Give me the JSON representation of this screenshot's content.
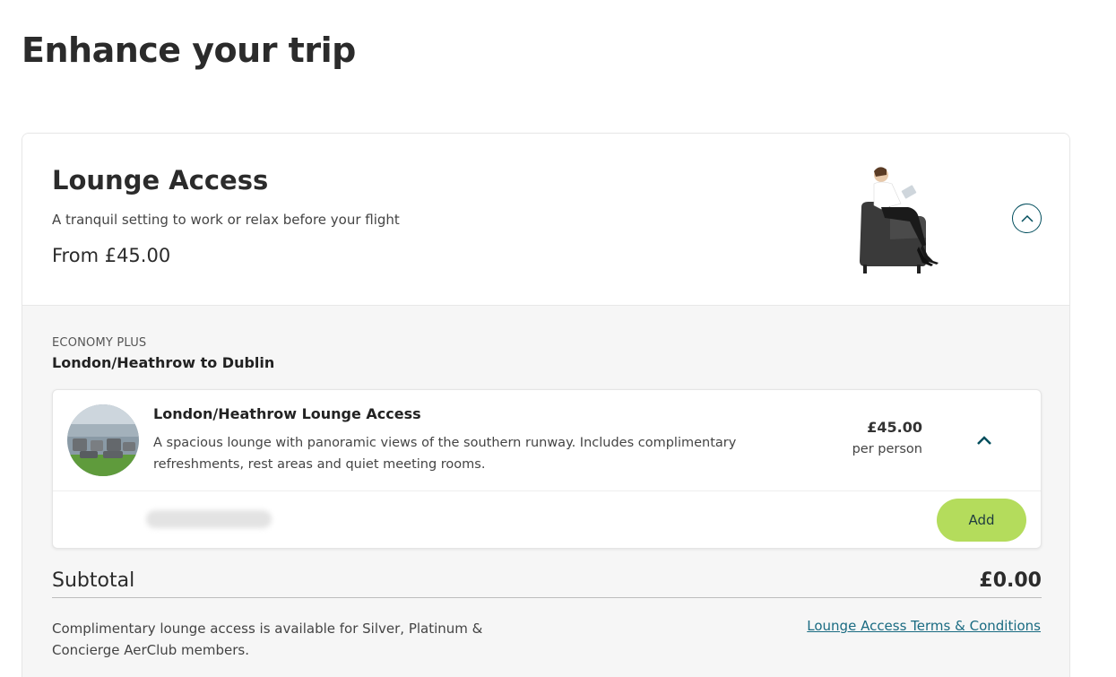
{
  "page": {
    "title": "Enhance your trip"
  },
  "lounge": {
    "title": "Lounge Access",
    "subtitle": "A tranquil setting to work or relax before your flight",
    "price_from": "From £45.00"
  },
  "flight": {
    "cabin": "ECONOMY PLUS",
    "route": "London/Heathrow to Dublin"
  },
  "item": {
    "name": "London/Heathrow Lounge Access",
    "description": "A spacious lounge with panoramic views of the southern runway. Includes complimentary refreshments, rest areas and quiet meeting rooms.",
    "price": "£45.00",
    "price_unit": "per person",
    "add_label": "Add"
  },
  "summary": {
    "subtotal_label": "Subtotal",
    "subtotal_value": "£0.00",
    "note": "Complimentary lounge access is available for Silver, Platinum & Concierge AerClub members.",
    "terms_link": "Lounge Access Terms & Conditions"
  },
  "colors": {
    "accent_teal": "#004d5c",
    "add_button": "#b4dc5c",
    "link": "#1a6b82"
  },
  "icons": {
    "collapse": "chevron-up-circle-icon",
    "item_collapse": "chevron-up-icon"
  }
}
